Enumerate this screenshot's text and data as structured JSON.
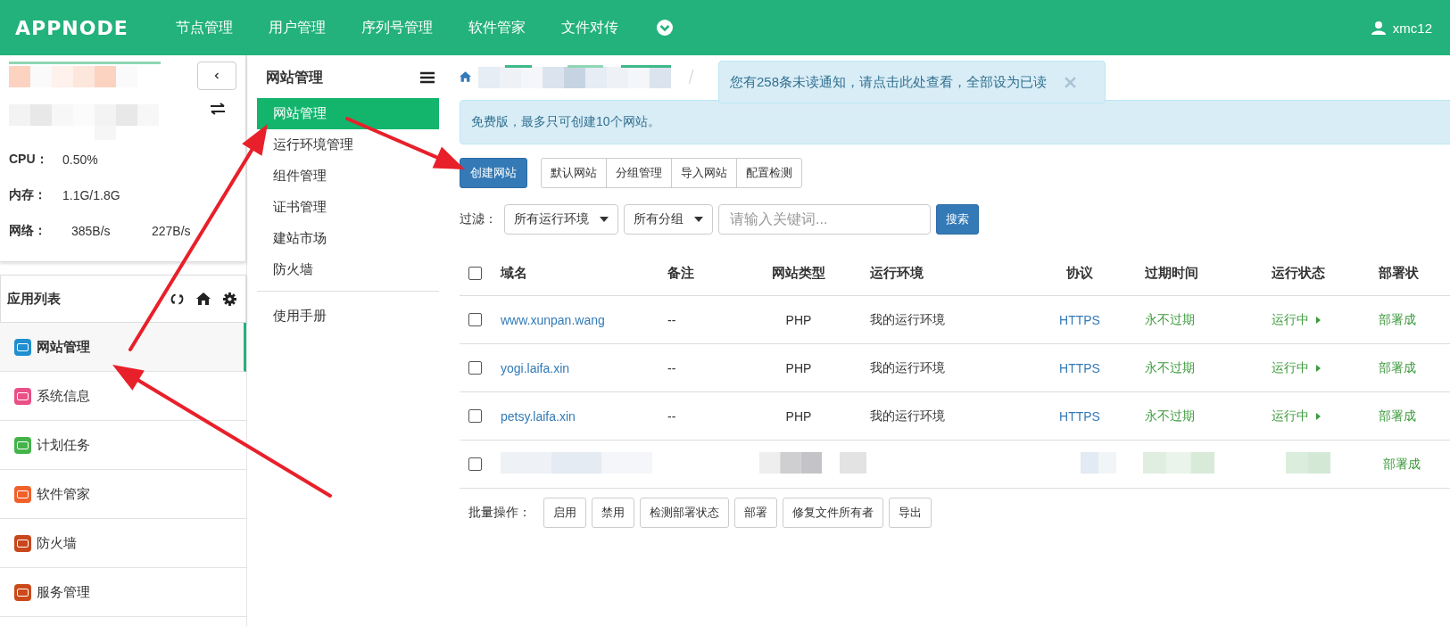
{
  "brand": "APPNODE",
  "top_nav": [
    "节点管理",
    "用户管理",
    "序列号管理",
    "软件管家",
    "文件对传"
  ],
  "user": "xmc12",
  "server_stats": [
    {
      "label": "CPU：",
      "values": [
        "0.50%"
      ]
    },
    {
      "label": "内存：",
      "values": [
        "1.1G/1.8G"
      ]
    },
    {
      "label": "网络：",
      "values": [
        "385B/s",
        "227B/s"
      ]
    }
  ],
  "app_list": {
    "title": "应用列表",
    "items": [
      {
        "label": "网站管理",
        "color": "#1f8fcf",
        "selected": true
      },
      {
        "label": "系统信息",
        "color": "#ea4f86",
        "selected": false
      },
      {
        "label": "计划任务",
        "color": "#43b34a",
        "selected": false
      },
      {
        "label": "软件管家",
        "color": "#f0602a",
        "selected": false
      },
      {
        "label": "防火墙",
        "color": "#c8471c",
        "selected": false
      },
      {
        "label": "服务管理",
        "color": "#cc4a1a",
        "selected": false
      }
    ]
  },
  "section_nav": {
    "title": "网站管理",
    "items": [
      {
        "label": "网站管理",
        "selected": true
      },
      {
        "label": "运行环境管理",
        "selected": false
      },
      {
        "label": "组件管理",
        "selected": false
      },
      {
        "label": "证书管理",
        "selected": false
      },
      {
        "label": "建站市场",
        "selected": false
      },
      {
        "label": "防火墙",
        "selected": false
      }
    ],
    "footer_items": [
      {
        "label": "使用手册",
        "selected": false
      }
    ]
  },
  "notification": {
    "text": "您有258条未读通知，请点击此处查看，全部设为已读"
  },
  "alert": "免费版，最多只可创建10个网站。",
  "toolbar": {
    "primary": "创建网站",
    "group": [
      "默认网站",
      "分组管理",
      "导入网站",
      "配置检测"
    ]
  },
  "filter": {
    "label": "过滤：",
    "selects": [
      "所有运行环境",
      "所有分组"
    ],
    "search": {
      "placeholder": "请输入关键词..."
    },
    "button": "搜索"
  },
  "table": {
    "header_checked": false,
    "columns": [
      "域名",
      "备注",
      "网站类型",
      "运行环境",
      "协议",
      "过期时间",
      "运行状态",
      "部署状"
    ],
    "rows": [
      {
        "checked": false,
        "redacted": false,
        "domain": "www.xunpan.wang",
        "note": "--",
        "type": "PHP",
        "env": "我的运行环境",
        "protocol": "HTTPS",
        "expiry": "永不过期",
        "status": "运行中",
        "deploy": "部署成"
      },
      {
        "checked": false,
        "redacted": false,
        "domain": "yogi.laifa.xin",
        "note": "--",
        "type": "PHP",
        "env": "我的运行环境",
        "protocol": "HTTPS",
        "expiry": "永不过期",
        "status": "运行中",
        "deploy": "部署成"
      },
      {
        "checked": false,
        "redacted": false,
        "domain": "petsy.laifa.xin",
        "note": "--",
        "type": "PHP",
        "env": "我的运行环境",
        "protocol": "HTTPS",
        "expiry": "永不过期",
        "status": "运行中",
        "deploy": "部署成"
      },
      {
        "checked": false,
        "redacted": true,
        "deploy": "部署成"
      }
    ]
  },
  "batch": {
    "label": "批量操作：",
    "buttons": [
      "启用",
      "禁用",
      "检测部署状态",
      "部署",
      "修复文件所有者",
      "导出"
    ]
  }
}
